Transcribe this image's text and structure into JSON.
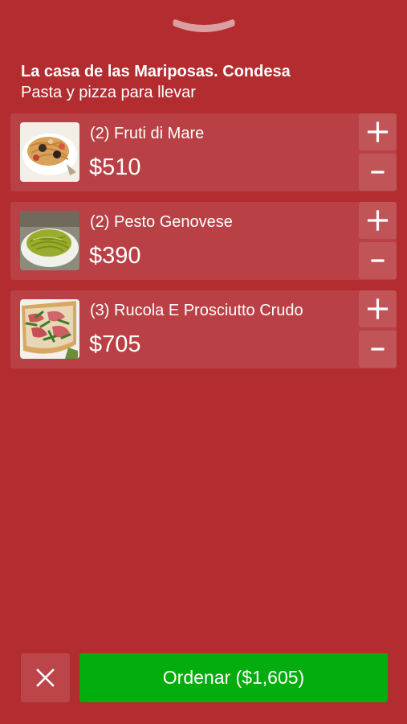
{
  "header": {
    "restaurant_name": "La casa de las Mariposas. Condesa",
    "subtitle": "Pasta y pizza para llevar"
  },
  "cart": {
    "items": [
      {
        "label": "(2) Fruti di Mare",
        "price": "$510",
        "image": "seafood-pasta-photo"
      },
      {
        "label": "(2) Pesto Genovese",
        "price": "$390",
        "image": "pesto-pasta-photo"
      },
      {
        "label": "(3) Rucola E Prosciutto Crudo",
        "price": "$705",
        "image": "prosciutto-pizza-photo"
      }
    ],
    "increase_symbol": "+",
    "decrease_symbol": "−"
  },
  "footer": {
    "order_label": "Ordenar ($1,605)",
    "cancel_icon": "close-icon"
  },
  "colors": {
    "background": "#b22c30",
    "order_button": "#03ad0d",
    "text": "#ffffff"
  }
}
